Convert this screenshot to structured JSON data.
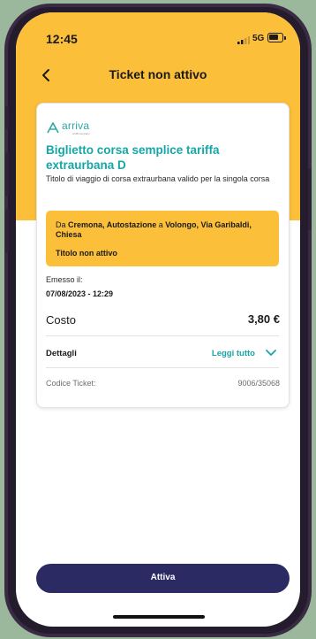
{
  "status_bar": {
    "time": "12:45",
    "network": "5G",
    "signal_icon": "signal-bars-icon",
    "battery_icon": "battery-icon"
  },
  "header": {
    "title": "Ticket non attivo",
    "back_icon": "chevron-left-icon"
  },
  "ticket": {
    "brand": "arriva",
    "brand_sub": "a DB company",
    "name": "Biglietto corsa semplice tariffa extraurbana D",
    "description": "Titolo di viaggio di corsa extraurbana valido per la singola corsa",
    "route": {
      "from_prefix": "Da ",
      "from": "Cremona, Autostazione",
      "to_prefix": " a ",
      "to": "Volongo, Via Garibaldi, Chiesa",
      "status": "Titolo non attivo"
    },
    "issued_label": "Emesso il:",
    "issued_value": "07/08/2023 - 12:29",
    "cost_label": "Costo",
    "cost_value": "3,80 €",
    "details_label": "Dettagli",
    "details_link": "Leggi tutto",
    "code_label": "Codice Ticket:",
    "code_value": "9006/35068"
  },
  "footer": {
    "activate_label": "Attiva"
  },
  "colors": {
    "accent_yellow": "#fbbf3a",
    "brand_teal": "#17a6a6",
    "button_navy": "#2c2a63"
  }
}
